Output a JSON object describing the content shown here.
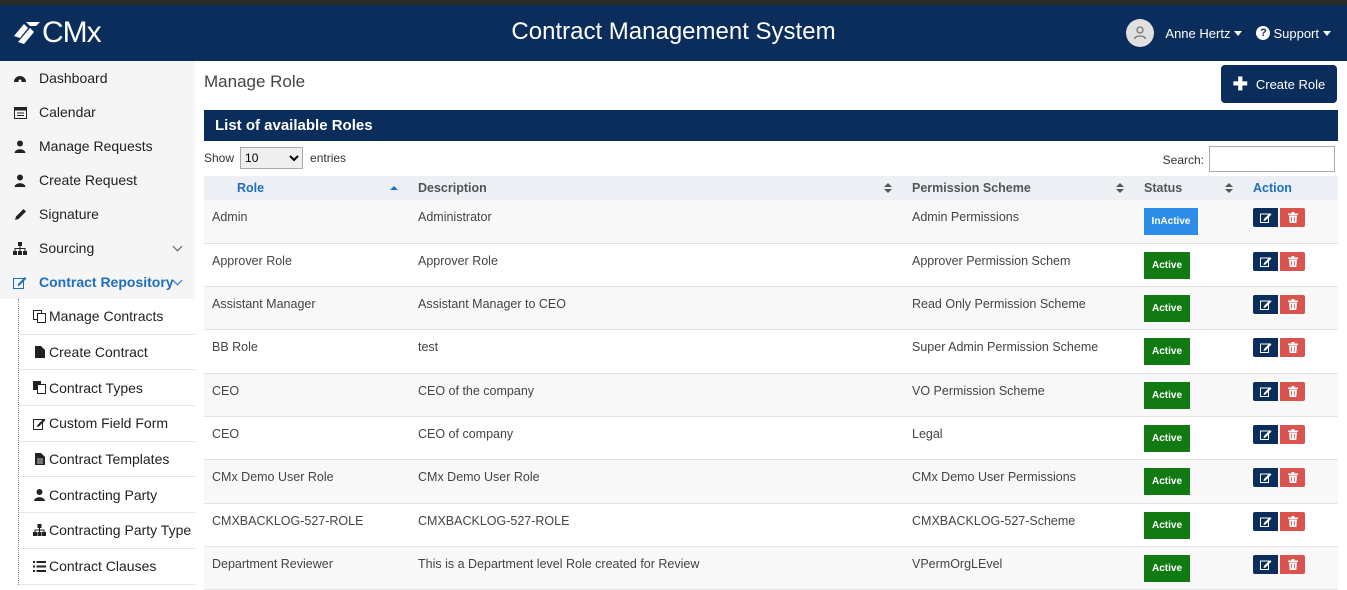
{
  "app": {
    "logo_text": "CMx",
    "title": "Contract Management System",
    "user_name": "Anne Hertz",
    "support_label": "Support"
  },
  "sidebar": {
    "items": [
      {
        "label": "Dashboard",
        "icon": "dashboard-icon"
      },
      {
        "label": "Calendar",
        "icon": "calendar-icon"
      },
      {
        "label": "Manage Requests",
        "icon": "user-tie-icon"
      },
      {
        "label": "Create Request",
        "icon": "user-tie-icon"
      },
      {
        "label": "Signature",
        "icon": "pen-icon"
      },
      {
        "label": "Sourcing",
        "icon": "sitemap-icon"
      },
      {
        "label": "Contract Repository",
        "icon": "edit-icon"
      }
    ],
    "subitems": [
      {
        "label": "Manage Contracts",
        "icon": "copy-icon"
      },
      {
        "label": "Create Contract",
        "icon": "file-icon"
      },
      {
        "label": "Contract Types",
        "icon": "copy-icon"
      },
      {
        "label": "Custom Field Form",
        "icon": "edit-icon"
      },
      {
        "label": "Contract Templates",
        "icon": "file-text-icon"
      },
      {
        "label": "Contracting Party",
        "icon": "user-icon"
      },
      {
        "label": "Contracting Party Type",
        "icon": "sitemap-icon"
      },
      {
        "label": "Contract Clauses",
        "icon": "list-icon"
      }
    ]
  },
  "main": {
    "page_title": "Manage Role",
    "create_button": "Create Role",
    "panel_title": "List of available Roles",
    "show_label": "Show",
    "entries_label": "entries",
    "page_size": "10",
    "search_label": "Search:",
    "search_value": ""
  },
  "table": {
    "headers": [
      "Role",
      "Description",
      "Permission Scheme",
      "Status",
      "Action"
    ],
    "rows": [
      {
        "role": "Admin",
        "description": "Administrator",
        "scheme": "Admin Permissions",
        "status": "InActive"
      },
      {
        "role": "Approver Role",
        "description": "Approver Role",
        "scheme": "Approver Permission Schem",
        "status": "Active"
      },
      {
        "role": "Assistant Manager",
        "description": "Assistant Manager to CEO",
        "scheme": "Read Only Permission Scheme",
        "status": "Active"
      },
      {
        "role": "BB Role",
        "description": "test",
        "scheme": "Super Admin Permission Scheme",
        "status": "Active"
      },
      {
        "role": "CEO",
        "description": "CEO of the company",
        "scheme": "VO Permission Scheme",
        "status": "Active"
      },
      {
        "role": "CEO",
        "description": "CEO of company",
        "scheme": "Legal",
        "status": "Active"
      },
      {
        "role": "CMx Demo User Role",
        "description": "CMx Demo User Role",
        "scheme": "CMx Demo User Permissions",
        "status": "Active"
      },
      {
        "role": "CMXBACKLOG-527-ROLE",
        "description": "CMXBACKLOG-527-ROLE",
        "scheme": "CMXBACKLOG-527-Scheme",
        "status": "Active"
      },
      {
        "role": "Department Reviewer",
        "description": "This is a Department level Role created for Review",
        "scheme": "VPermOrgLEvel",
        "status": "Active"
      }
    ]
  },
  "colors": {
    "brand": "#0b2d5b",
    "active": "#127a12",
    "inactive": "#2e8de6",
    "delete": "#d9534f",
    "link": "#1f6fbf"
  }
}
